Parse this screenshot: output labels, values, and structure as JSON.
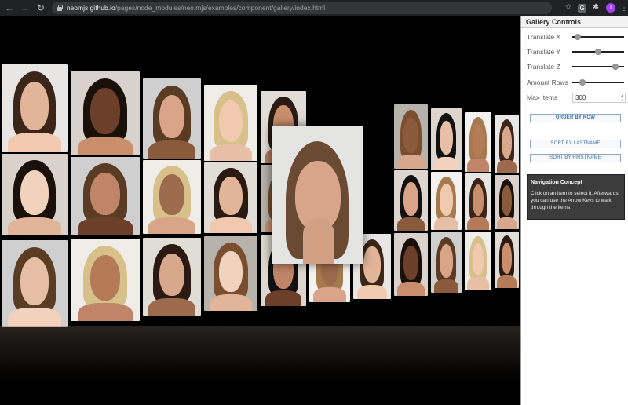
{
  "browser": {
    "url_host": "neomjs.github.io",
    "url_path": "/pages/node_modules/neo.mjs/examples/component/gallery/index.html",
    "profile_initial": "T",
    "extension_label": "G"
  },
  "panel": {
    "title": "Gallery Controls",
    "controls": [
      {
        "label": "Translate X",
        "value_fraction": 0.05
      },
      {
        "label": "Translate Y",
        "value_fraction": 0.5
      },
      {
        "label": "Translate Z",
        "value_fraction": 0.88
      },
      {
        "label": "Amount Rows",
        "value_fraction": 0.15
      }
    ],
    "max_items": {
      "label": "Max Items",
      "value": "300"
    },
    "buttons": {
      "order": "ORDER BY ROW",
      "lastname": "SORT BY LASTNAME",
      "firstname": "SORT BY FIRSTNAME"
    },
    "navigation": {
      "title": "Navigation Concept",
      "text": "Click on an item to select it. Afterwards you can use the Arrow Keys to walk through the items."
    }
  },
  "colors": {
    "accent": "#3a6ea5",
    "panel_bg": "#ffffff",
    "gallery_bg": "#000000"
  }
}
